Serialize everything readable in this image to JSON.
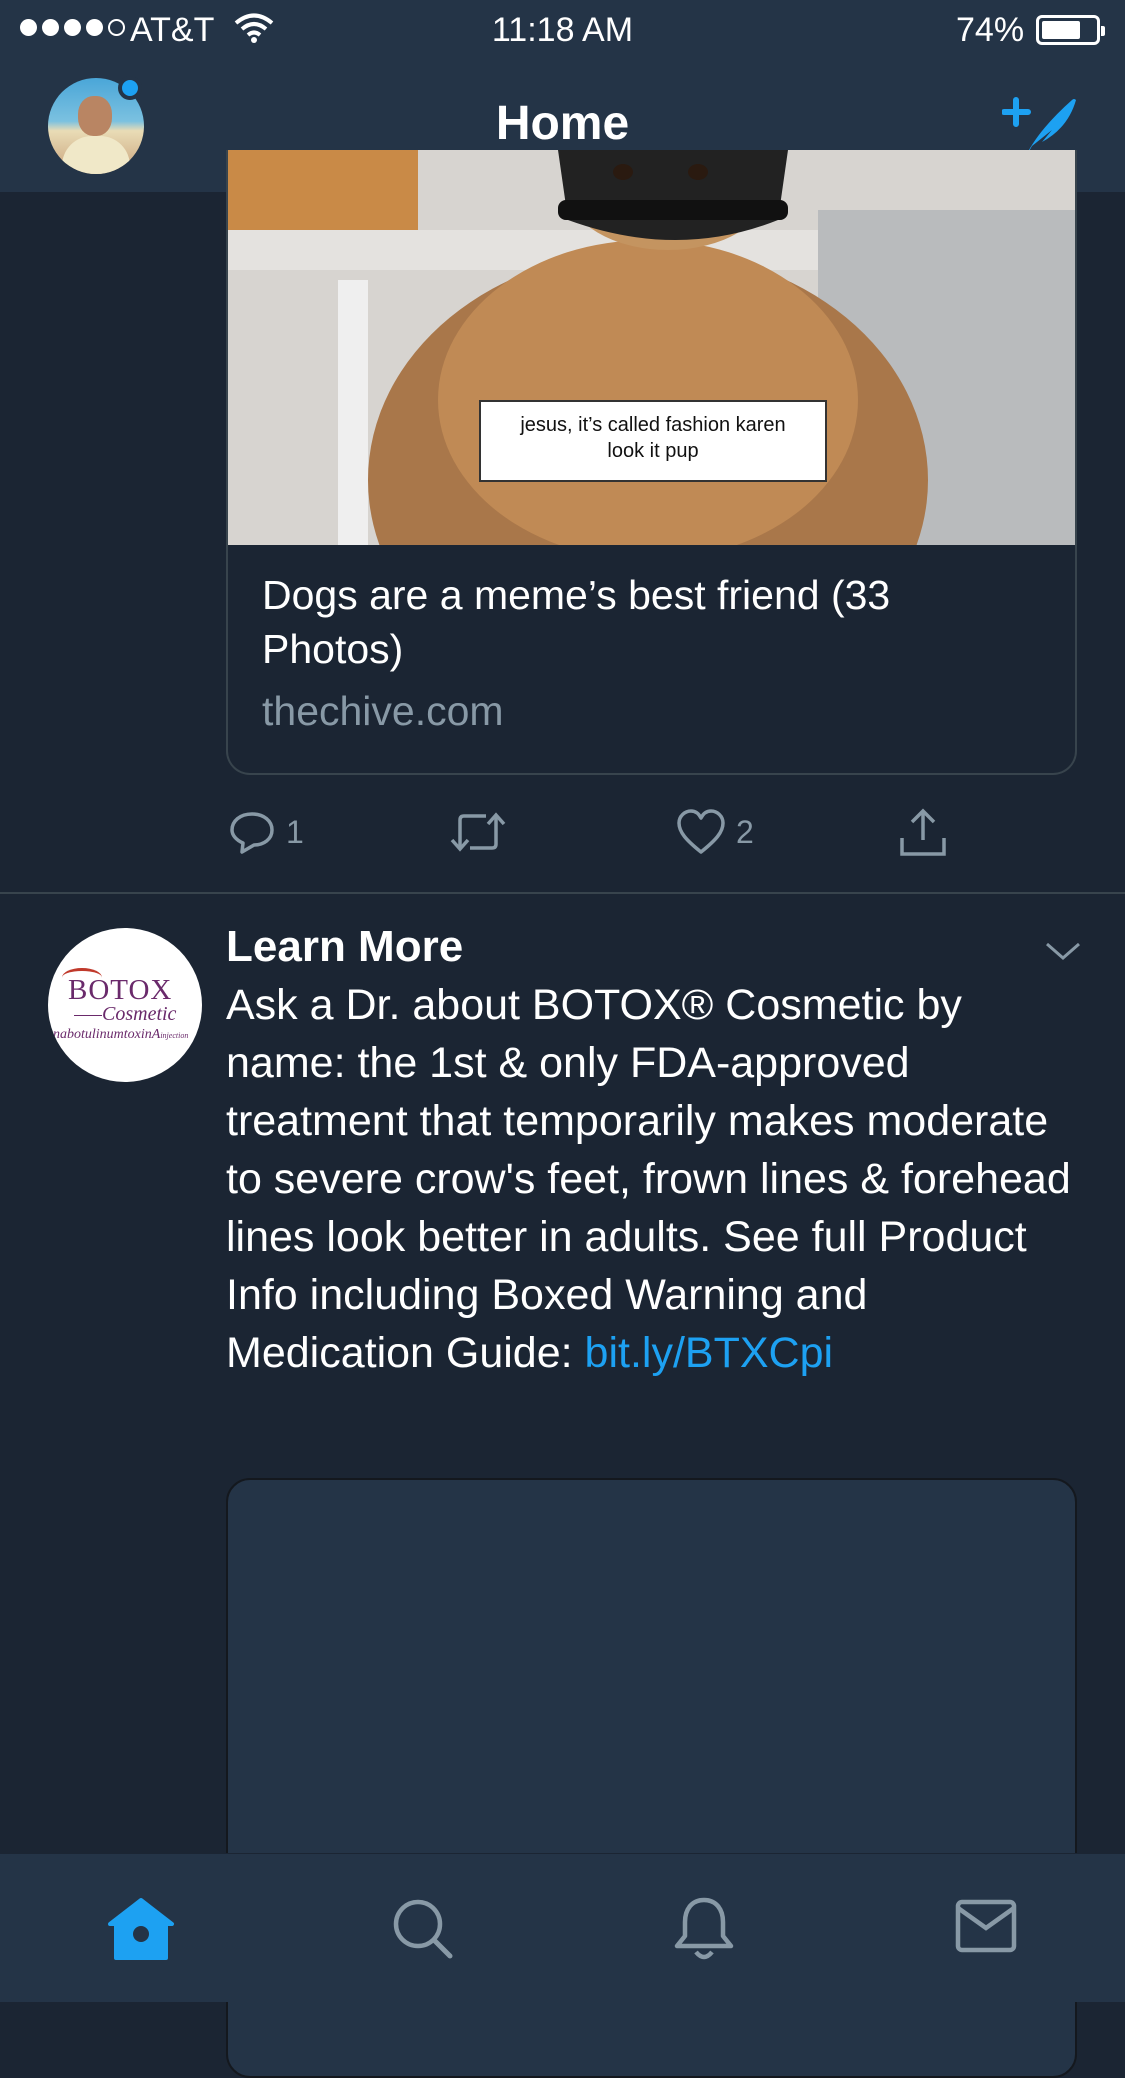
{
  "status_bar": {
    "carrier": "AT&T",
    "time": "11:18 AM",
    "battery_percent": "74%",
    "battery_level": 0.74
  },
  "header": {
    "title": "Home"
  },
  "tweet_card": {
    "image_caption_line1": "jesus, it’s called fashion karen",
    "image_caption_line2": "look it pup",
    "title": "Dogs are a meme’s best friend (33 Photos)",
    "domain": "thechive.com",
    "reply_count": "1",
    "like_count": "2"
  },
  "promoted_tweet": {
    "author_name": "Learn More",
    "avatar_brand": "BOTOX",
    "avatar_sub": "Cosmetic",
    "avatar_generic": "onabotulinumtoxinA",
    "avatar_generic_suffix": "injection",
    "text": "Ask a Dr. about BOTOX® Cosmetic by name: the 1st & only FDA-approved treatment that temporarily makes moderate to severe crow's feet, frown lines & forehead lines look better in adults. See full Product Info including Boxed Warning and Medication Guide:",
    "link": "bit.ly/BTXCpi"
  },
  "colors": {
    "background": "#1b2533",
    "bar": "#243447",
    "accent": "#1da1f2",
    "muted": "#8899a6"
  },
  "tabs": [
    {
      "icon": "home-icon"
    },
    {
      "icon": "search-icon"
    },
    {
      "icon": "bell-icon"
    },
    {
      "icon": "mail-icon"
    }
  ]
}
